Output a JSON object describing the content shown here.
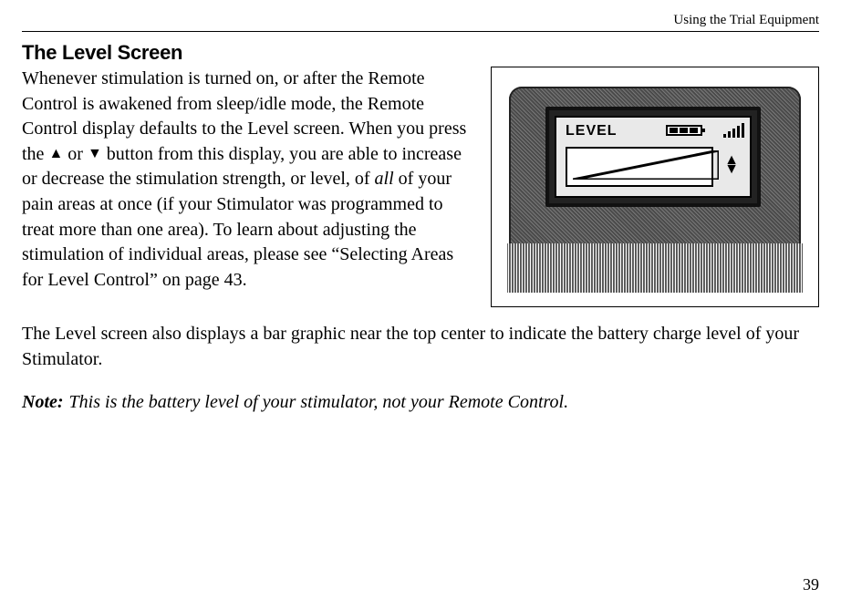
{
  "header": {
    "running_head": "Using the Trial Equipment"
  },
  "section": {
    "title": "The Level Screen"
  },
  "paragraphs": {
    "p1_a": "Whenever stimulation is turned on, or after the Remote Control is awakened from sleep/idle mode, the Remote Control display defaults to the Level screen. When you press the ",
    "p1_b": " or ",
    "p1_c": " button from this display, you are able to increase or decrease the stimulation strength, or level, of ",
    "p1_all": "all",
    "p1_d": " of your pain areas at once (if your Stimulator was programmed to treat more than one area). To learn about adjusting the stimulation of individual areas, please see “Selecting Areas for Level Control” on page 43.",
    "p2": "The Level screen also displays a bar graphic near the top center to indicate the battery charge level of your Stimulator."
  },
  "symbols": {
    "up": "▲",
    "down": "▼"
  },
  "note": {
    "label": "Note:",
    "text": "This is the battery level of your stimulator, not your Remote Control."
  },
  "device": {
    "lcd_title": "LEVEL",
    "arrows": "▲\n▼"
  },
  "page": {
    "number": "39"
  }
}
